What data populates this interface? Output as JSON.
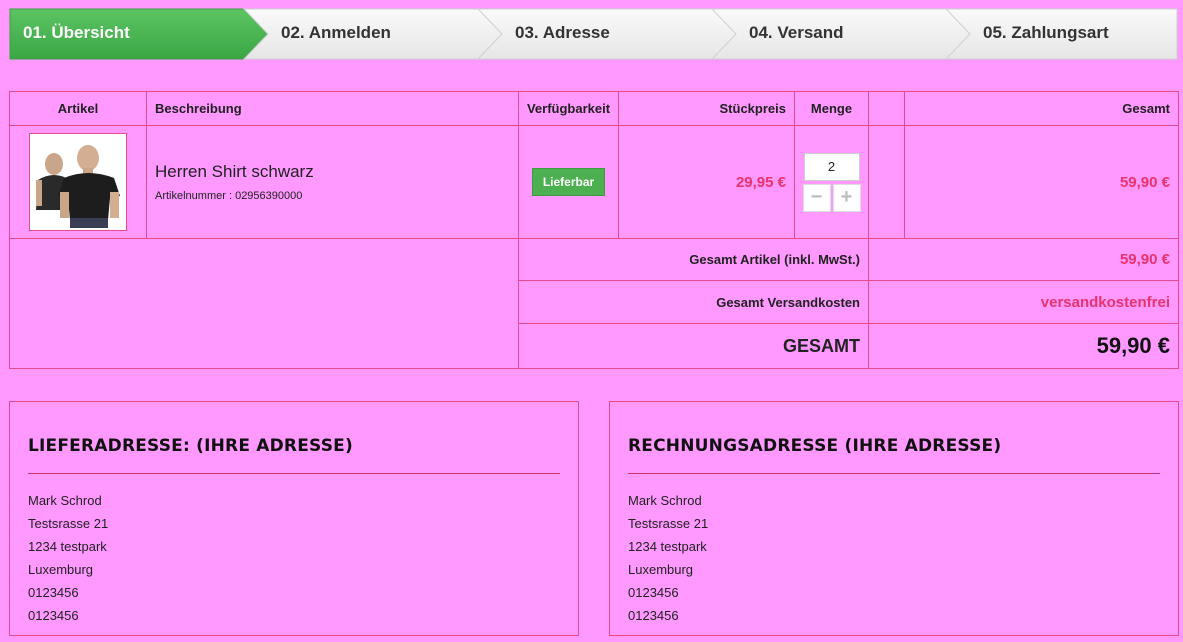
{
  "steps": [
    {
      "label": "01. Übersicht",
      "active": true
    },
    {
      "label": "02. Anmelden",
      "active": false
    },
    {
      "label": "03. Adresse",
      "active": false
    },
    {
      "label": "04. Versand",
      "active": false
    },
    {
      "label": "05. Zahlungsart",
      "active": false
    }
  ],
  "cart": {
    "headers": {
      "article": "Artikel",
      "description": "Beschreibung",
      "availability": "Verfügbarkeit",
      "unit_price": "Stückpreis",
      "quantity": "Menge",
      "total": "Gesamt"
    },
    "items": [
      {
        "name": "Herren Shirt schwarz",
        "article_number": "Artikelnummer : 02956390000",
        "availability": "Lieferbar",
        "unit_price": "29,95 €",
        "quantity": "2",
        "total": "59,90 €",
        "minus": "−",
        "plus": "+"
      }
    ],
    "summary": {
      "articles_label": "Gesamt Artikel (inkl. MwSt.)",
      "articles_value": "59,90 €",
      "shipping_label": "Gesamt Versandkosten",
      "shipping_value": "versandkostenfrei",
      "grand_label": "GESAMT",
      "grand_value": "59,90 €"
    }
  },
  "delivery_address": {
    "title": "LIEFERADRESSE: (IHRE ADRESSE)",
    "lines": [
      "Mark Schrod",
      "Testsrasse 21",
      "1234 testpark",
      "Luxemburg",
      "0123456",
      "0123456"
    ]
  },
  "billing_address": {
    "title": "RECHNUNGSADRESSE (IHRE ADRESSE)",
    "lines": [
      "Mark Schrod",
      "Testsrasse 21",
      "1234 testpark",
      "Luxemburg",
      "0123456",
      "0123456"
    ]
  },
  "colors": {
    "background": "#ff99ff",
    "border": "#e64a8a",
    "price": "#e8336d",
    "active_step": "#46b150",
    "available_badge": "#4caf50"
  }
}
